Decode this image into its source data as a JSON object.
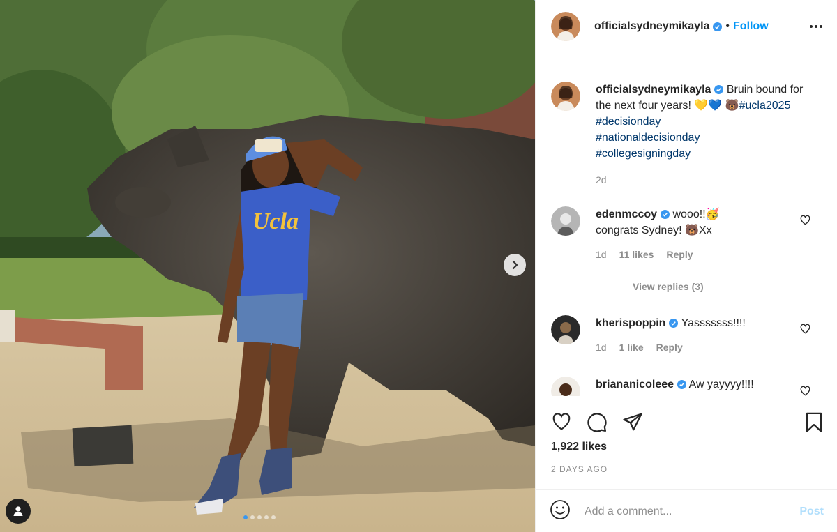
{
  "post": {
    "author": "officialsydneymikayla",
    "follow_label": "Follow",
    "separator": "•"
  },
  "caption": {
    "username": "officialsydneymikayla",
    "text": "Bruin bound for the next four years! 💛💙",
    "emoji": "🐻",
    "hashtags": [
      "#ucla2025",
      "#decisionday",
      "#nationaldecisionday",
      "#collegesigningday"
    ],
    "time": "2d"
  },
  "comments": [
    {
      "username": "edenmccoy",
      "text_line1": "wooo!!🥳",
      "text_line2": "congrats Sydney! 🐻Xx",
      "time": "1d",
      "likes": "11 likes",
      "reply": "Reply"
    },
    {
      "username": "kherispoppin",
      "text_line1": "Yasssssss!!!!",
      "time": "1d",
      "likes": "1 like",
      "reply": "Reply"
    },
    {
      "username": "briananicoleee",
      "text_line1": "Aw yayyyy!!!!"
    }
  ],
  "view_replies": "View replies (3)",
  "likes": "1,922 likes",
  "date": "2 DAYS AGO",
  "add_comment": {
    "placeholder": "Add a comment...",
    "post_label": "Post"
  },
  "photo": {
    "shirt_text": "Ucla",
    "carousel_position": 1,
    "carousel_count": 5
  },
  "colors": {
    "accent": "#0095f6",
    "hashtag": "#00376b",
    "muted": "#8e8e8e",
    "verified": "#3897f0",
    "shirt": "#3b5fc8",
    "shirt_text": "#f3c23d"
  },
  "icons": [
    "verified-icon",
    "more-icon",
    "heart-icon",
    "comment-icon",
    "share-icon",
    "bookmark-icon",
    "emoji-icon",
    "next-arrow-icon",
    "user-tag-icon"
  ]
}
